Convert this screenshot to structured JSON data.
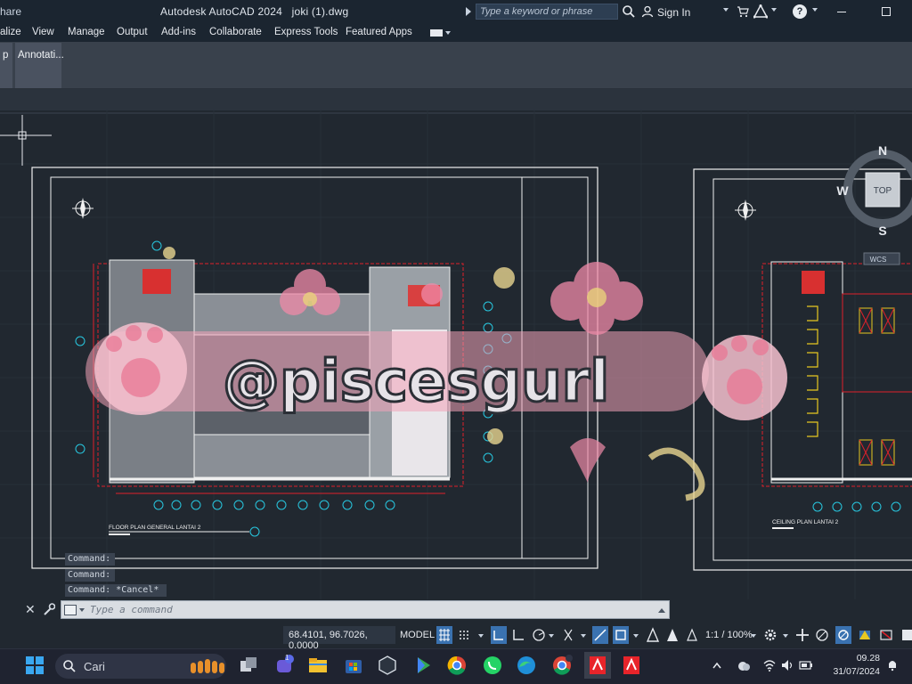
{
  "titlebar": {
    "share_fragment": "hare",
    "app_title": "Autodesk AutoCAD 2024",
    "file_name": "joki (1).dwg",
    "search_placeholder": "Type a keyword or phrase",
    "sign_in": "Sign In",
    "help_glyph": "?"
  },
  "menu": {
    "items": [
      "alize",
      "View",
      "Manage",
      "Output",
      "Add-ins",
      "Collaborate",
      "Express Tools",
      "Featured Apps"
    ]
  },
  "ribbon": {
    "tabs": [
      "p",
      "Annotati..."
    ]
  },
  "drawing": {
    "viewcube": {
      "north": "N",
      "south": "S",
      "west": "W",
      "face": "TOP",
      "wcs": "WCS"
    },
    "floorplan_1_title": "FLOOR PLAN GENERAL LANTAI 2",
    "floorplan_2_title": "CEILING PLAN LANTAI 2",
    "watermark_text": "@piscesgurl"
  },
  "command": {
    "history": [
      "Command:",
      "Command:",
      "Command: *Cancel*"
    ],
    "placeholder": "Type a command"
  },
  "status": {
    "coordinates": "68.4101, 96.7026, 0.0000",
    "space": "MODEL",
    "scale": "1:1 / 100%"
  },
  "taskbar": {
    "search_text": "Cari",
    "time": "09.28",
    "date": "31/07/2024",
    "teams_badge": "1"
  },
  "colors": {
    "canvas": "#212830",
    "ribbon": "#39414c",
    "accent_blue": "#3a72b0",
    "red_dim": "#e0202a",
    "cyan_grid": "#28c8e0",
    "pink_sticker": "#f2a3b8"
  }
}
